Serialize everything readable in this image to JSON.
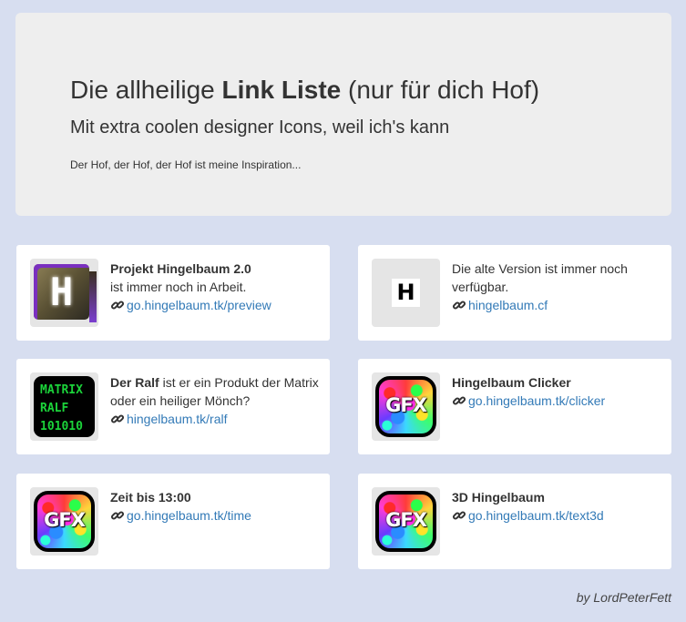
{
  "hero": {
    "title_prefix": "Die allheilige ",
    "title_bold": "Link Liste",
    "title_suffix": " (nur für dich Hof)",
    "subtitle": "Mit extra coolen designer Icons, weil ich's kann",
    "tagline": "Der Hof, der Hof, der Hof ist meine Inspiration..."
  },
  "cards": [
    {
      "title": "Projekt Hingelbaum 2.0",
      "text": "ist immer noch in Arbeit.",
      "link": "go.hingelbaum.tk/preview",
      "icon": "H-cube-icon",
      "icon_letter": "H"
    },
    {
      "text": "Die alte Version ist immer noch verfügbar.",
      "link": "hingelbaum.cf",
      "icon": "H-box-icon",
      "icon_letter": "H"
    },
    {
      "title": "Der Ralf",
      "text": " ist er ein Produkt der Matrix oder ein heiliger Mönch?",
      "link": "hingelbaum.tk/ralf",
      "icon": "matrix-icon",
      "icon_text": "MATRIX\nRALF\n101010"
    },
    {
      "title": "Hingelbaum Clicker",
      "link": "go.hingelbaum.tk/clicker",
      "icon": "gfx-icon",
      "icon_text": "GFX"
    },
    {
      "title": "Zeit bis 13:00",
      "link": "go.hingelbaum.tk/time",
      "icon": "gfx-icon",
      "icon_text": "GFX"
    },
    {
      "title": "3D Hingelbaum",
      "link": "go.hingelbaum.tk/text3d",
      "icon": "gfx-icon",
      "icon_text": "GFX"
    }
  ],
  "footer": {
    "credit": "by LordPeterFett"
  },
  "colors": {
    "background": "#d7def0",
    "hero": "#eeeeee",
    "link": "#337ab7"
  }
}
